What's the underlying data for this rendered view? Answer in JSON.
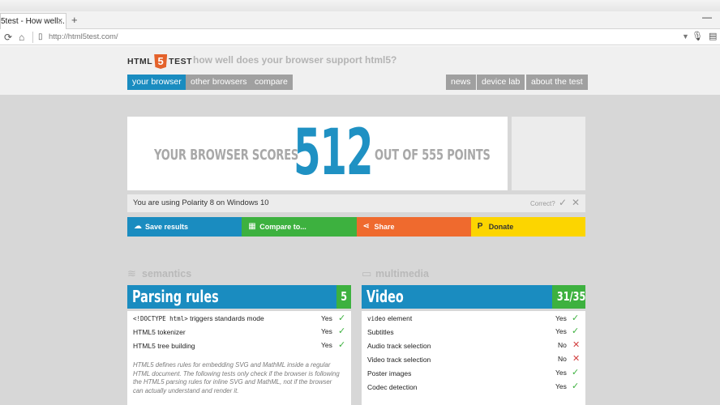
{
  "browser": {
    "tab_title": "5test - How well...",
    "tab_close": "×",
    "new_tab": "+",
    "minimize": "—",
    "url_prefix": "http://",
    "url_host": "html5test.com/"
  },
  "site": {
    "logo_html": "HTML",
    "logo_5": "5",
    "logo_test": "TEST",
    "tagline": "how well does your browser support html5?",
    "nav_left": [
      "your browser",
      "other browsers",
      "compare"
    ],
    "nav_right": [
      "news",
      "device lab",
      "about the test"
    ]
  },
  "score": {
    "prefix": "YOUR BROWSER SCORES",
    "value": "512",
    "suffix": "OUT OF 555 POINTS"
  },
  "detected": {
    "text": "You are using Polarity 8 on Windows 10",
    "correct_label": "Correct?"
  },
  "actions": {
    "save": "Save results",
    "compare": "Compare to...",
    "share": "Share",
    "donate": "Donate"
  },
  "sections": {
    "semantics": {
      "label": "semantics",
      "category": "Parsing rules",
      "score": "5",
      "rows": [
        {
          "code": "<!DOCTYPE html>",
          "text": " triggers standards mode",
          "result": "Yes"
        },
        {
          "code": "",
          "text": "HTML5 tokenizer",
          "result": "Yes"
        },
        {
          "code": "",
          "text": "HTML5 tree building",
          "result": "Yes"
        }
      ],
      "note": "HTML5 defines rules for embedding SVG and MathML inside a regular HTML document. The following tests only check if the browser is following the HTML5 parsing rules for inline SVG and MathML, not if the browser can actually understand and render it."
    },
    "multimedia": {
      "label": "multimedia",
      "category": "Video",
      "score": "31/35",
      "rows": [
        {
          "code": "video",
          "text": " element",
          "result": "Yes"
        },
        {
          "code": "",
          "text": "Subtitles",
          "result": "Yes"
        },
        {
          "code": "",
          "text": "Audio track selection",
          "result": "No"
        },
        {
          "code": "",
          "text": "Video track selection",
          "result": "No"
        },
        {
          "code": "",
          "text": "Poster images",
          "result": "Yes"
        },
        {
          "code": "",
          "text": "Codec detection",
          "result": "Yes"
        }
      ]
    }
  },
  "colors": {
    "blue": "#1a8cc0",
    "green": "#3db13f",
    "orange": "#ef6a2e",
    "yellow": "#fcd500",
    "html5_orange": "#e4622b"
  }
}
